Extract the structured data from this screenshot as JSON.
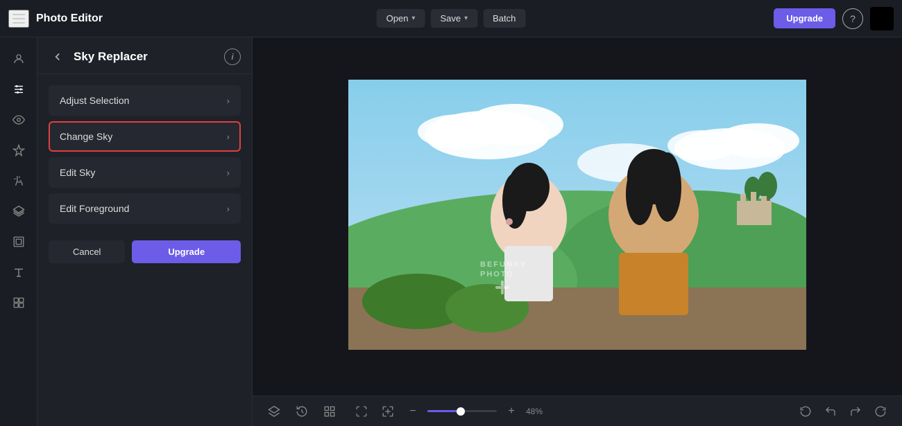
{
  "app": {
    "title": "Photo Editor",
    "hamburger_label": "Menu"
  },
  "header": {
    "open_label": "Open",
    "save_label": "Save",
    "batch_label": "Batch",
    "upgrade_label": "Upgrade",
    "help_label": "?"
  },
  "panel": {
    "title": "Sky Replacer",
    "back_label": "←",
    "info_label": "i",
    "menu_items": [
      {
        "id": "adjust-selection",
        "label": "Adjust Selection",
        "active": false
      },
      {
        "id": "change-sky",
        "label": "Change Sky",
        "active": true
      },
      {
        "id": "edit-sky",
        "label": "Edit Sky",
        "active": false
      },
      {
        "id": "edit-foreground",
        "label": "Edit Foreground",
        "active": false
      }
    ],
    "cancel_label": "Cancel",
    "upgrade_label": "Upgrade"
  },
  "bottom_toolbar": {
    "zoom_level": "48%",
    "tools_left": [
      {
        "id": "layers",
        "icon": "layers"
      },
      {
        "id": "history",
        "icon": "history"
      },
      {
        "id": "grid",
        "icon": "grid"
      }
    ],
    "tools_center": [
      {
        "id": "fit",
        "icon": "fit"
      },
      {
        "id": "crop-fit",
        "icon": "crop-fit"
      }
    ],
    "tools_right": [
      {
        "id": "rotate-ccw",
        "icon": "rotate-ccw"
      },
      {
        "id": "undo",
        "icon": "undo"
      },
      {
        "id": "redo",
        "icon": "redo"
      },
      {
        "id": "rotate-cw",
        "icon": "rotate-cw"
      }
    ]
  },
  "sidebar_icons": [
    {
      "id": "face",
      "label": "Face"
    },
    {
      "id": "sliders",
      "label": "Adjustments"
    },
    {
      "id": "eye",
      "label": "View"
    },
    {
      "id": "sparkle",
      "label": "Effects"
    },
    {
      "id": "touch",
      "label": "Touch up"
    },
    {
      "id": "layers2",
      "label": "Layers"
    },
    {
      "id": "frames",
      "label": "Frames"
    },
    {
      "id": "text",
      "label": "Text"
    },
    {
      "id": "graphics",
      "label": "Graphics"
    }
  ]
}
